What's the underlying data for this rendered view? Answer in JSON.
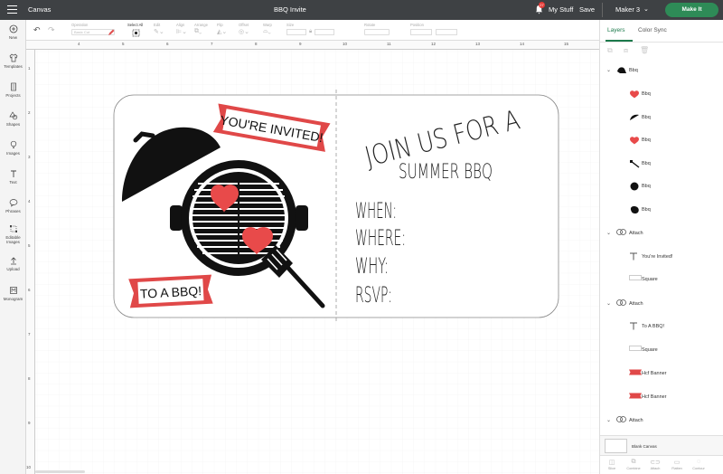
{
  "topbar": {
    "app_section": "Canvas",
    "project_title": "BBQ Invite",
    "notification_count": "27",
    "my_stuff": "My Stuff",
    "save": "Save",
    "machine": "Maker 3",
    "make_it": "Make It"
  },
  "leftbar": {
    "items": [
      "New",
      "Templates",
      "Projects",
      "Shapes",
      "Images",
      "Text",
      "Phrases",
      "Editable Images",
      "Upload",
      "Monogram"
    ]
  },
  "toolbar": {
    "operation_label": "Operation",
    "operation_value": "Basic Cut",
    "select_all": "Select All",
    "edit": "Edit",
    "align": "Align",
    "arrange": "Arrange",
    "flip": "Flip",
    "offset": "Offset",
    "warp": "Warp",
    "size": "Size",
    "rotate": "Rotate",
    "position": "Position"
  },
  "ruler": {
    "top": [
      "4",
      "5",
      "6",
      "7",
      "8",
      "9",
      "10",
      "11",
      "12",
      "13",
      "14",
      "15"
    ],
    "left": [
      "1",
      "2",
      "3",
      "4",
      "5",
      "6",
      "7",
      "8",
      "9",
      "10"
    ]
  },
  "design": {
    "youre_invited": "YOU'RE INVITED!",
    "to_a_bbq": "TO A BBQ!",
    "join_line": "JOIN US FOR A",
    "summer_line": "SUMMER BBQ",
    "when": "WHEN:",
    "where": "WHERE:",
    "why": "WHY:",
    "rsvp": "RSVP:"
  },
  "right_panel": {
    "tabs": [
      "Layers",
      "Color Sync"
    ],
    "layers": [
      {
        "label": "Bbq",
        "kind": "group"
      },
      {
        "label": "Bbq",
        "kind": "heart-red"
      },
      {
        "label": "Bbq",
        "kind": "lid-black"
      },
      {
        "label": "Bbq",
        "kind": "heart-red"
      },
      {
        "label": "Bbq",
        "kind": "spatula-black"
      },
      {
        "label": "Bbq",
        "kind": "circle-black"
      },
      {
        "label": "Bbq",
        "kind": "blob-black"
      },
      {
        "label": "Attach",
        "kind": "attach"
      },
      {
        "label": "You're Invited!",
        "kind": "text"
      },
      {
        "label": "Square",
        "kind": "square"
      },
      {
        "label": "Attach",
        "kind": "attach"
      },
      {
        "label": "To A BBQ!",
        "kind": "text"
      },
      {
        "label": "Square",
        "kind": "square"
      },
      {
        "label": "Hcf Banner",
        "kind": "banner"
      },
      {
        "label": "Hcf Banner",
        "kind": "banner"
      },
      {
        "label": "Attach",
        "kind": "attach"
      }
    ],
    "blank_canvas": "Blank Canvas",
    "bottom": [
      "Slice",
      "Combine",
      "Attach",
      "Flatten",
      "Contour"
    ]
  },
  "colors": {
    "accent_green": "#2e8b57",
    "banner_red": "#e04848",
    "heart_red": "#e84a4a",
    "ink": "#111111"
  }
}
